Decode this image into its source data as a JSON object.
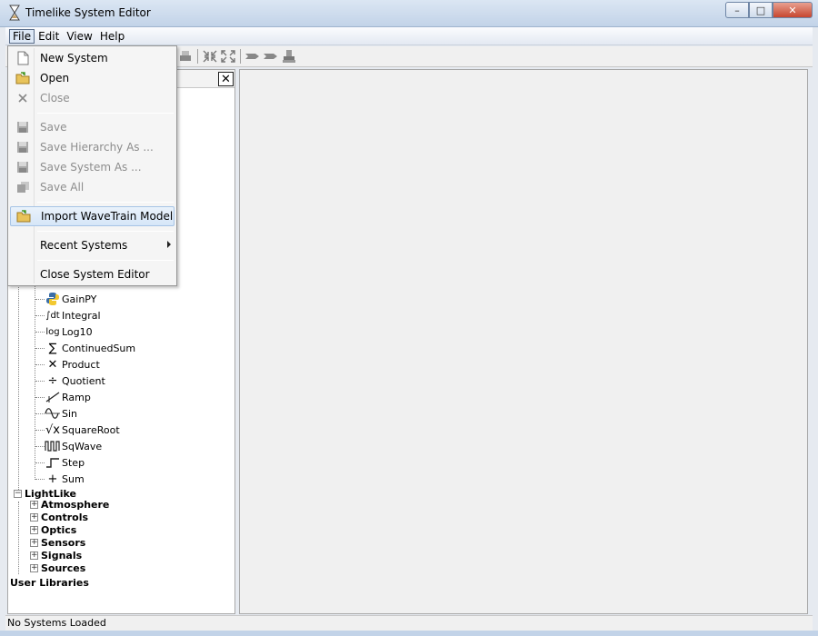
{
  "window": {
    "title": "Timelike System Editor",
    "minimize": "–",
    "maximize": "□",
    "close": "✕"
  },
  "menubar": {
    "file": "File",
    "edit": "Edit",
    "view": "View",
    "help": "Help"
  },
  "file_menu": {
    "new_system": "New System",
    "open": "Open",
    "close": "Close",
    "save": "Save",
    "save_hierarchy_as": "Save Hierarchy As ...",
    "save_system_as": "Save System As ...",
    "save_all": "Save All",
    "import_wavetrain": "Import WaveTrain Model",
    "recent_systems": "Recent Systems",
    "close_system_editor": "Close System Editor"
  },
  "tree": {
    "blocks": [
      {
        "label": "GainPY",
        "icon": "python-icon",
        "glyph": ""
      },
      {
        "label": "Integral",
        "icon": "integral-icon",
        "glyph": "∫dt"
      },
      {
        "label": "Log10",
        "icon": "log-icon",
        "glyph": "log"
      },
      {
        "label": "ContinuedSum",
        "icon": "sigma-icon",
        "glyph": "∑"
      },
      {
        "label": "Product",
        "icon": "multiply-icon",
        "glyph": "✕"
      },
      {
        "label": "Quotient",
        "icon": "divide-icon",
        "glyph": "÷"
      },
      {
        "label": "Ramp",
        "icon": "ramp-icon",
        "glyph": ""
      },
      {
        "label": "Sin",
        "icon": "sine-icon",
        "glyph": ""
      },
      {
        "label": "SquareRoot",
        "icon": "sqrt-icon",
        "glyph": "√x"
      },
      {
        "label": "SqWave",
        "icon": "square-wave-icon",
        "glyph": ""
      },
      {
        "label": "Step",
        "icon": "step-icon",
        "glyph": ""
      },
      {
        "label": "Sum",
        "icon": "plus-icon",
        "glyph": "+"
      }
    ],
    "lightlike": {
      "label": "LightLike",
      "children": [
        "Atmosphere",
        "Controls",
        "Optics",
        "Sensors",
        "Signals",
        "Sources"
      ]
    },
    "user_libraries": "User Libraries"
  },
  "status": {
    "text": "No Systems Loaded"
  }
}
